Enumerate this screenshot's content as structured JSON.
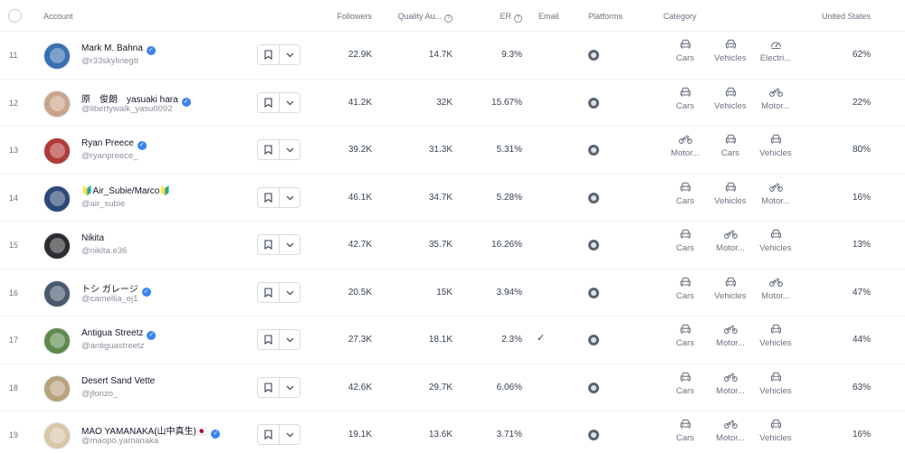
{
  "header": {
    "account": "Account",
    "followers": "Followers",
    "quality": "Quality Au...",
    "er": "ER",
    "email": "Email",
    "platforms": "Platforms",
    "category": "Category",
    "country": "United States"
  },
  "rows": [
    {
      "index": "11",
      "name": "Mark M. Bahna",
      "verified": true,
      "handle": "@r33skylinegtr",
      "followers": "22.9K",
      "quality": "14.7K",
      "er": "9.3%",
      "email": "",
      "categories": [
        {
          "icon": "car-icon",
          "label": "Cars"
        },
        {
          "icon": "car-icon",
          "label": "Vehicles"
        },
        {
          "icon": "gauge-icon",
          "label": "Electri..."
        }
      ],
      "us": "62%",
      "avatar_color": "#3a6fb0"
    },
    {
      "index": "12",
      "name": "原　俊朗　yasuaki hara",
      "verified": true,
      "handle": "@libertywalk_yasu0092",
      "followers": "41.2K",
      "quality": "32K",
      "er": "15.67%",
      "email": "",
      "categories": [
        {
          "icon": "car-icon",
          "label": "Cars"
        },
        {
          "icon": "car-icon",
          "label": "Vehicles"
        },
        {
          "icon": "motorcycle-icon",
          "label": "Motor..."
        }
      ],
      "us": "22%",
      "avatar_color": "#c9a48a"
    },
    {
      "index": "13",
      "name": "Ryan Preece",
      "verified": true,
      "handle": "@ryanpreece_",
      "followers": "39.2K",
      "quality": "31.3K",
      "er": "5.31%",
      "email": "",
      "categories": [
        {
          "icon": "motorcycle-icon",
          "label": "Motor..."
        },
        {
          "icon": "car-icon",
          "label": "Cars"
        },
        {
          "icon": "car-icon",
          "label": "Vehicles"
        }
      ],
      "us": "80%",
      "avatar_color": "#b23a3a"
    },
    {
      "index": "14",
      "name": "🔰Air_Subie/Marco🔰",
      "verified": false,
      "handle": "@air_subie",
      "followers": "46.1K",
      "quality": "34.7K",
      "er": "5.28%",
      "email": "",
      "categories": [
        {
          "icon": "car-icon",
          "label": "Cars"
        },
        {
          "icon": "car-icon",
          "label": "Vehicles"
        },
        {
          "icon": "motorcycle-icon",
          "label": "Motor..."
        }
      ],
      "us": "16%",
      "avatar_color": "#2c4a78"
    },
    {
      "index": "15",
      "name": "Nikita",
      "verified": false,
      "handle": "@nikita.e36",
      "followers": "42.7K",
      "quality": "35.7K",
      "er": "16.26%",
      "email": "",
      "categories": [
        {
          "icon": "car-icon",
          "label": "Cars"
        },
        {
          "icon": "motorcycle-icon",
          "label": "Motor..."
        },
        {
          "icon": "car-icon",
          "label": "Vehicles"
        }
      ],
      "us": "13%",
      "avatar_color": "#2b2d31"
    },
    {
      "index": "16",
      "name": "トシ ガレージ",
      "verified": true,
      "handle": "@camellia_ej1",
      "followers": "20.5K",
      "quality": "15K",
      "er": "3.94%",
      "email": "",
      "categories": [
        {
          "icon": "car-icon",
          "label": "Cars"
        },
        {
          "icon": "car-icon",
          "label": "Vehicles"
        },
        {
          "icon": "motorcycle-icon",
          "label": "Motor..."
        }
      ],
      "us": "47%",
      "avatar_color": "#4a5a6e"
    },
    {
      "index": "17",
      "name": "Antigua Streetz",
      "verified": true,
      "handle": "@antiguastreetz",
      "followers": "27.3K",
      "quality": "18.1K",
      "er": "2.3%",
      "email": "✓",
      "categories": [
        {
          "icon": "car-icon",
          "label": "Cars"
        },
        {
          "icon": "motorcycle-icon",
          "label": "Motor..."
        },
        {
          "icon": "car-icon",
          "label": "Vehicles"
        }
      ],
      "us": "44%",
      "avatar_color": "#5f8a4c"
    },
    {
      "index": "18",
      "name": "Desert Sand Vette",
      "verified": false,
      "handle": "@jfonzo_",
      "followers": "42.6K",
      "quality": "29.7K",
      "er": "6.06%",
      "email": "",
      "categories": [
        {
          "icon": "car-icon",
          "label": "Cars"
        },
        {
          "icon": "motorcycle-icon",
          "label": "Motor..."
        },
        {
          "icon": "car-icon",
          "label": "Vehicles"
        }
      ],
      "us": "63%",
      "avatar_color": "#b8a27c"
    },
    {
      "index": "19",
      "name": "MAO YAMANAKA(山中真生)🇯🇵",
      "verified": true,
      "handle": "@maopo.yamanaka",
      "followers": "19.1K",
      "quality": "13.6K",
      "er": "3.71%",
      "email": "",
      "categories": [
        {
          "icon": "car-icon",
          "label": "Cars"
        },
        {
          "icon": "motorcycle-icon",
          "label": "Motor..."
        },
        {
          "icon": "car-icon",
          "label": "Vehicles"
        }
      ],
      "us": "16%",
      "avatar_color": "#d9c7a8"
    }
  ]
}
